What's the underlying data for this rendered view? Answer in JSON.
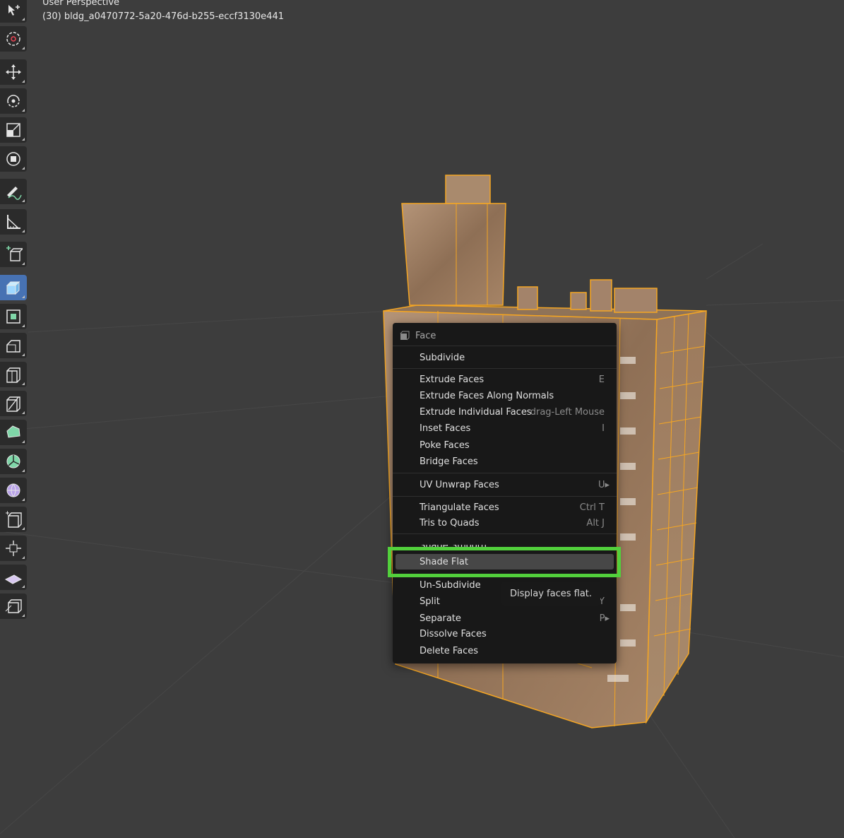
{
  "viewport": {
    "view_name": "User Perspective",
    "object_name": "(30) bldg_a0470772-5a20-476d-b255-eccf3130e441"
  },
  "colors": {
    "background": "#3d3d3d",
    "selection_orange": "#f5a623",
    "active_tool": "#4772b3",
    "highlight_green": "#52d03c"
  },
  "toolbar": {
    "tools": [
      {
        "name": "select-box-icon"
      },
      {
        "name": "cursor-icon"
      },
      {
        "name": "move-icon"
      },
      {
        "name": "rotate-icon"
      },
      {
        "name": "scale-icon"
      },
      {
        "name": "transform-icon"
      },
      {
        "name": "annotate-icon"
      },
      {
        "name": "measure-icon"
      },
      {
        "name": "add-cube-icon"
      },
      {
        "name": "extrude-region-icon",
        "active": true
      },
      {
        "name": "inset-faces-icon"
      },
      {
        "name": "bevel-icon"
      },
      {
        "name": "loop-cut-icon"
      },
      {
        "name": "knife-icon"
      },
      {
        "name": "poly-build-icon"
      },
      {
        "name": "spin-icon"
      },
      {
        "name": "smooth-icon"
      },
      {
        "name": "edge-slide-icon"
      },
      {
        "name": "shrink-fatten-icon"
      },
      {
        "name": "shear-icon"
      },
      {
        "name": "rip-region-icon"
      }
    ]
  },
  "menu": {
    "title": "Face",
    "items": {
      "subdivide": {
        "label": "Subdivide",
        "shortcut": ""
      },
      "extrude_faces": {
        "label": "Extrude Faces",
        "shortcut": "E"
      },
      "extrude_along_normals": {
        "label": "Extrude Faces Along Normals",
        "shortcut": ""
      },
      "extrude_individual": {
        "label": "Extrude Individual Faces",
        "shortcut": "drag-Left Mouse"
      },
      "inset_faces": {
        "label": "Inset Faces",
        "shortcut": "I"
      },
      "poke_faces": {
        "label": "Poke Faces",
        "shortcut": ""
      },
      "bridge_faces": {
        "label": "Bridge Faces",
        "shortcut": ""
      },
      "uv_unwrap": {
        "label": "UV Unwrap Faces",
        "shortcut": "U▸"
      },
      "triangulate": {
        "label": "Triangulate Faces",
        "shortcut": "Ctrl T"
      },
      "tris_to_quads": {
        "label": "Tris to Quads",
        "shortcut": "Alt J"
      },
      "shade_smooth": {
        "label": "Shade Smooth",
        "shortcut": ""
      },
      "shade_flat": {
        "label": "Shade Flat",
        "shortcut": ""
      },
      "un_subdivide": {
        "label": "Un-Subdivide",
        "shortcut": ""
      },
      "split": {
        "label": "Split",
        "shortcut": "Y"
      },
      "separate": {
        "label": "Separate",
        "shortcut": "P▸"
      },
      "dissolve_faces": {
        "label": "Dissolve Faces",
        "shortcut": ""
      },
      "delete_faces": {
        "label": "Delete Faces",
        "shortcut": ""
      }
    }
  },
  "tooltip": {
    "text": "Display faces flat."
  }
}
